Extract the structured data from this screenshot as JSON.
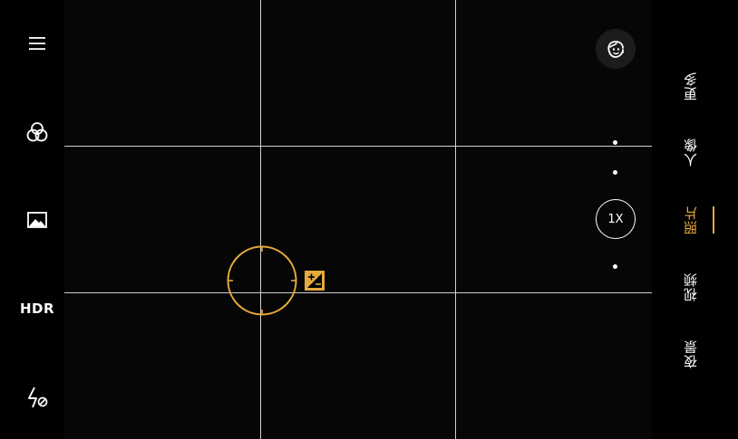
{
  "left_controls": {
    "menu_icon": "hamburger-menu-icon",
    "filter_icon": "color-filter-icon",
    "gallery_icon": "image-gallery-icon",
    "hdr_label": "HDR",
    "flash_icon": "flash-auto-icon"
  },
  "viewfinder": {
    "focus_color": "#e5a93c",
    "exposure_icon": "exposure-compensation-icon",
    "portrait_toggle_icon": "face-beauty-icon",
    "zoom_label": "1X"
  },
  "modes": {
    "items": [
      {
        "label": "更多",
        "active": false
      },
      {
        "label": "人像",
        "active": false
      },
      {
        "label": "照片",
        "active": true
      },
      {
        "label": "视频",
        "active": false
      },
      {
        "label": "夜景",
        "active": false
      }
    ],
    "active_color": "#e5a93c"
  }
}
